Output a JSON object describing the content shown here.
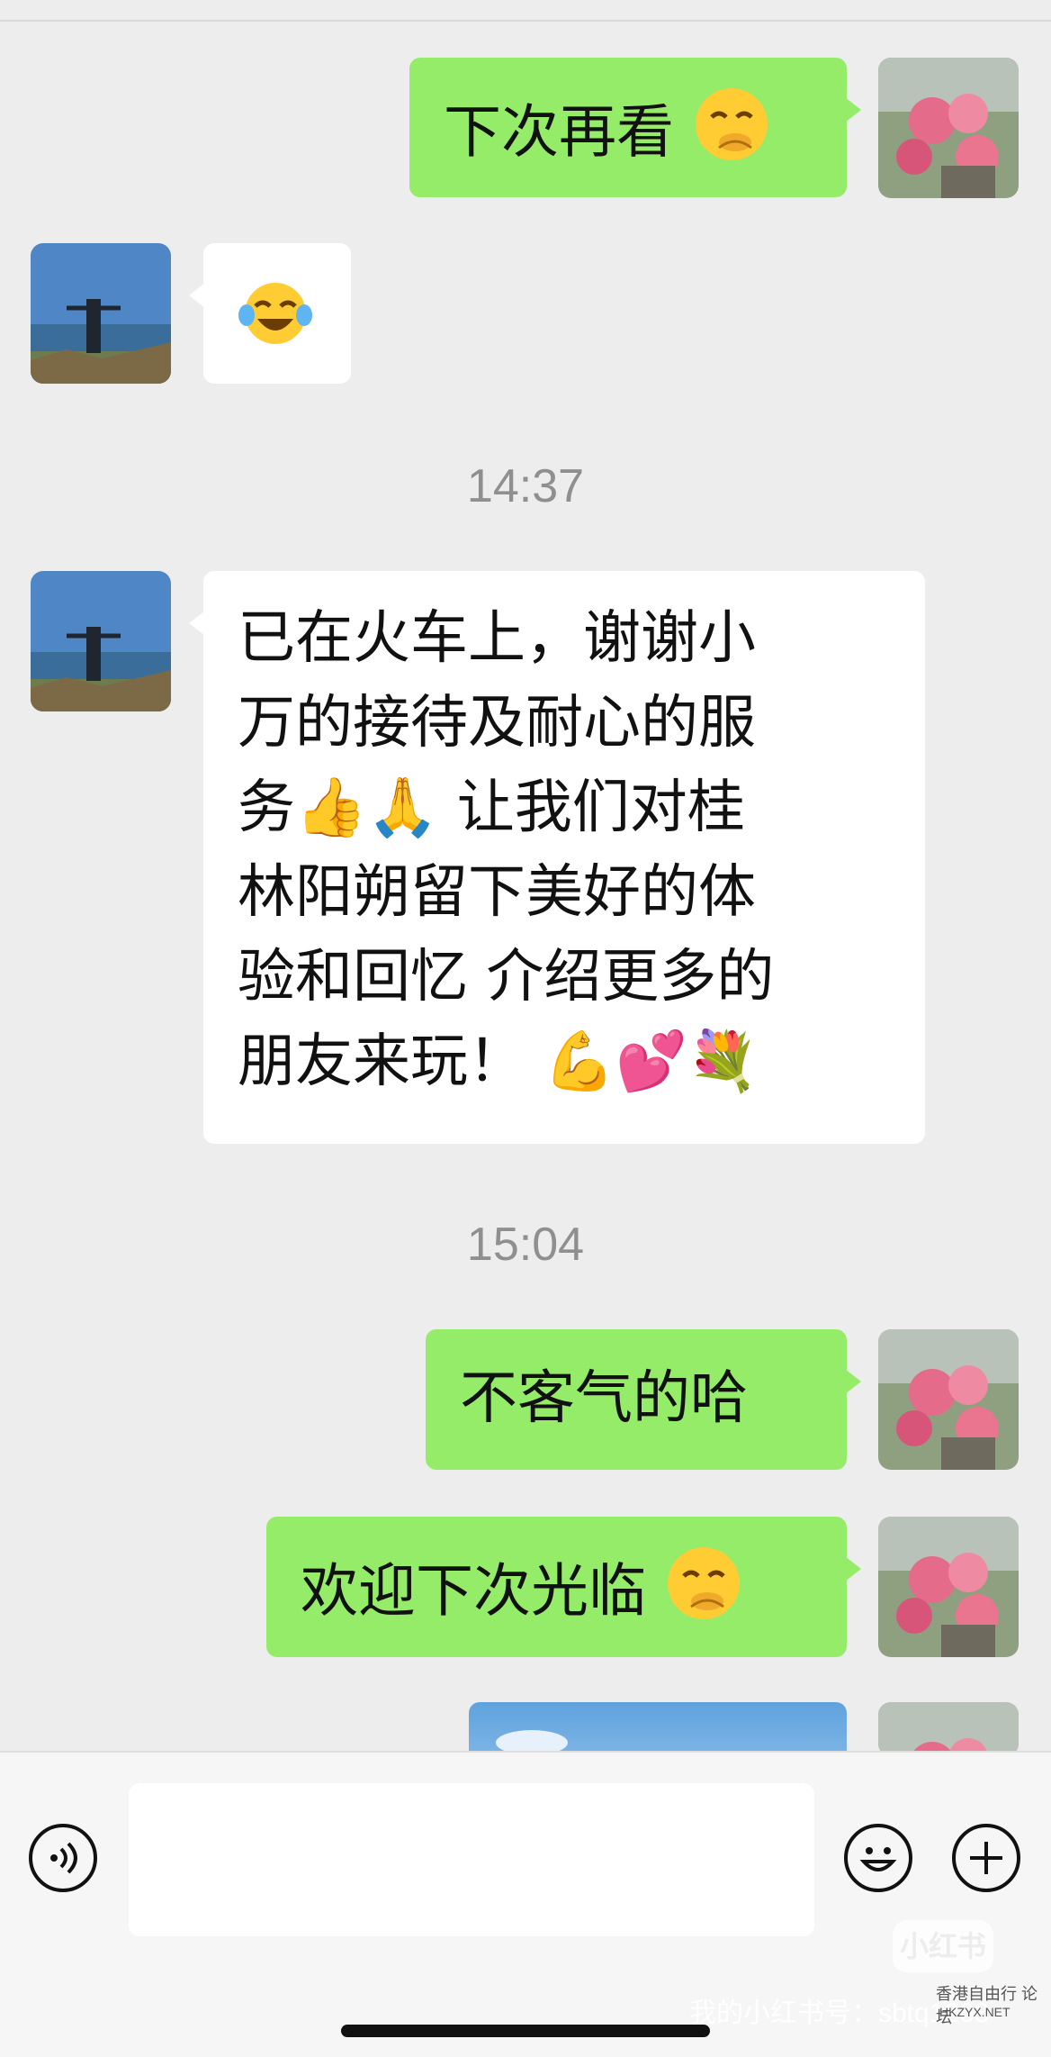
{
  "messages": [
    {
      "side": "out",
      "text": "下次再看",
      "emoji": "hand-over-mouth"
    },
    {
      "side": "in",
      "text": "",
      "emoji": "tears-of-joy"
    },
    {
      "time": "14:37"
    },
    {
      "side": "in",
      "lines": [
        "已在火车上，谢谢小",
        "万的接待及耐心的服",
        "务👍🙏 让我们对桂",
        "林阳朔留下美好的体",
        "验和回忆 介绍更多的",
        "朋友来玩！ 💪💕💐"
      ]
    },
    {
      "time": "15:04"
    },
    {
      "side": "out",
      "text": "不客气的哈"
    },
    {
      "side": "out",
      "text": "欢迎下次光临",
      "emoji": "hand-over-mouth"
    },
    {
      "side": "out",
      "type": "image"
    }
  ],
  "timestamps": {
    "t1": "14:37",
    "t2": "15:04"
  },
  "bubble_texts": {
    "m1": "下次再看",
    "m4": "不客气的哈",
    "m5": "欢迎下次光临",
    "long": [
      "已在火车上，谢谢小",
      "万的接待及耐心的服",
      "务👍🙏 让我们对桂",
      "林阳朔留下美好的体",
      "验和回忆 介绍更多的",
      "朋友来玩！ 💪💕💐"
    ]
  },
  "input_bar": {
    "voice_icon": "voice-icon",
    "emoji_icon": "emoji-icon",
    "plus_icon": "plus-icon",
    "input_value": ""
  },
  "watermark": {
    "logo": "小红书",
    "text": "我的小红书号：sbtq1268",
    "forum": "香港自由行 论坛",
    "forum_url": "HKZYX.NET"
  },
  "colors": {
    "outgoing": "#95ec69",
    "incoming": "#ffffff",
    "background": "#ededed"
  }
}
